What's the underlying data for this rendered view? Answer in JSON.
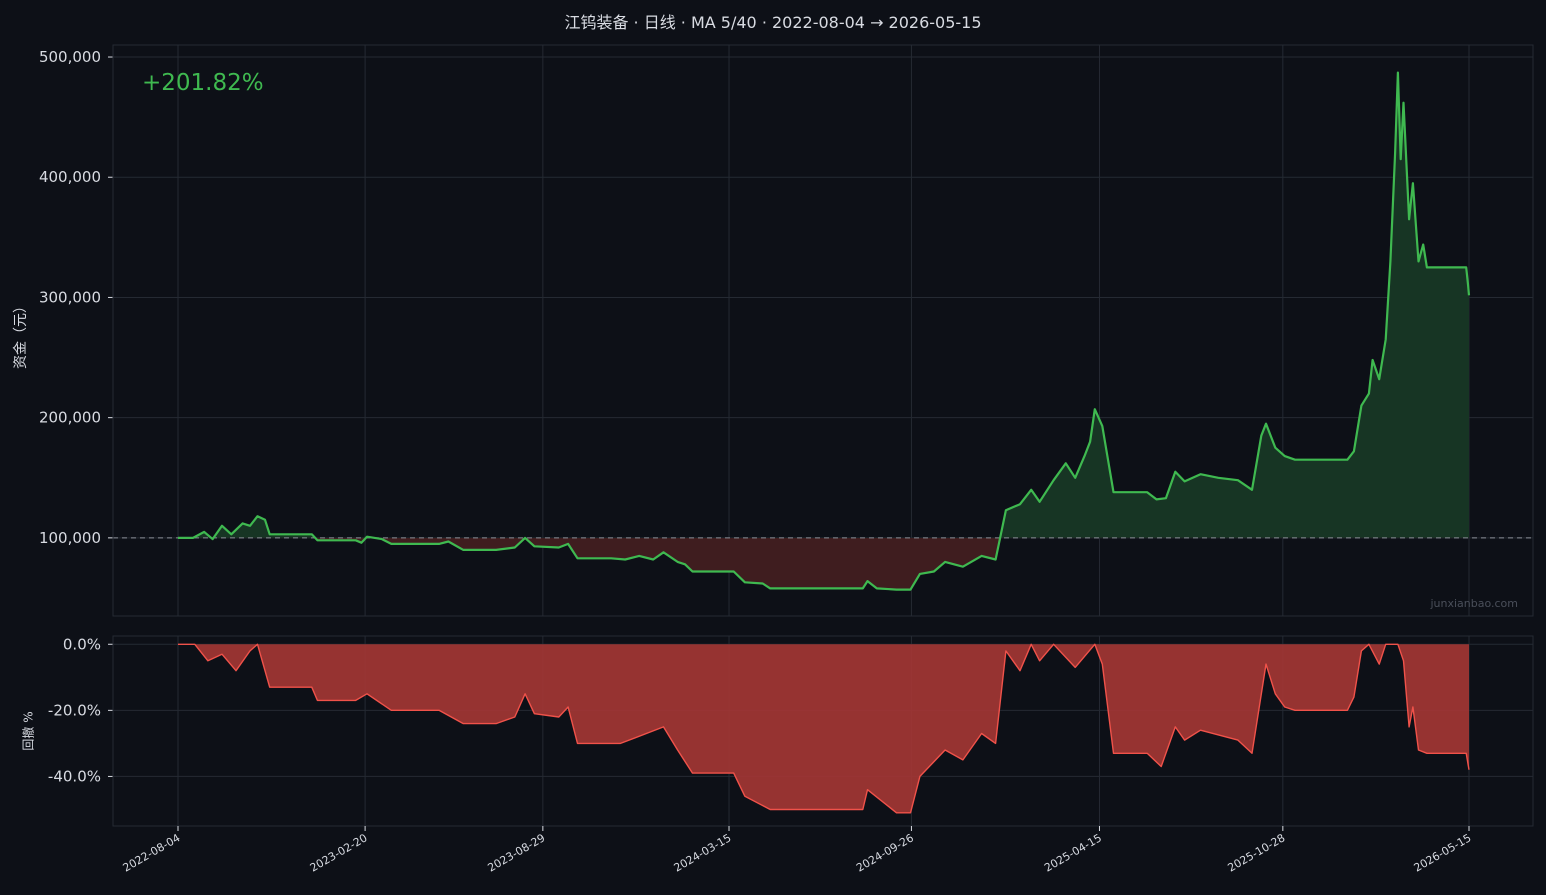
{
  "title": "江钨装备 · 日线 · MA 5/40 · 2022-08-04 → 2026-05-15",
  "return_label": "+201.82%",
  "watermark": "junxianbao.com",
  "colors": {
    "background": "#0d1017",
    "grid": "#252a33",
    "equity_line": "#3fb950",
    "gain_fill": "#173524",
    "loss_fill": "#3f1d1f",
    "drawdown_line": "#f0524a",
    "drawdown_fill": "#a23634",
    "baseline": "#8b8f98",
    "text": "#d8dbe2"
  },
  "chart_data": [
    {
      "type": "line",
      "ylabel": "资金（元）",
      "ylim": [
        35000,
        510000
      ],
      "yticks": [
        100000,
        200000,
        300000,
        400000,
        500000
      ],
      "ytick_labels": [
        "100,000",
        "200,000",
        "300,000",
        "400,000",
        "500,000"
      ],
      "baseline": 100000,
      "grid": true,
      "annotation": "+201.82%",
      "series": [
        {
          "values": [
            [
              "2022-08-04",
              100000
            ],
            [
              "2022-08-20",
              100000
            ],
            [
              "2022-09-01",
              105000
            ],
            [
              "2022-09-10",
              99000
            ],
            [
              "2022-09-20",
              110000
            ],
            [
              "2022-09-30",
              103000
            ],
            [
              "2022-10-12",
              112000
            ],
            [
              "2022-10-20",
              110000
            ],
            [
              "2022-10-28",
              118000
            ],
            [
              "2022-11-05",
              115000
            ],
            [
              "2022-11-10",
              103000
            ],
            [
              "2022-12-25",
              103000
            ],
            [
              "2022-12-31",
              98000
            ],
            [
              "2023-02-10",
              98000
            ],
            [
              "2023-02-16",
              96000
            ],
            [
              "2023-02-22",
              101000
            ],
            [
              "2023-03-10",
              99000
            ],
            [
              "2023-03-20",
              95000
            ],
            [
              "2023-05-10",
              95000
            ],
            [
              "2023-05-20",
              97000
            ],
            [
              "2023-06-05",
              90000
            ],
            [
              "2023-07-10",
              90000
            ],
            [
              "2023-07-30",
              92000
            ],
            [
              "2023-08-10",
              100000
            ],
            [
              "2023-08-20",
              93000
            ],
            [
              "2023-09-15",
              92000
            ],
            [
              "2023-09-25",
              95000
            ],
            [
              "2023-10-05",
              83000
            ],
            [
              "2023-11-10",
              83000
            ],
            [
              "2023-11-25",
              82000
            ],
            [
              "2023-12-10",
              85000
            ],
            [
              "2023-12-25",
              82000
            ],
            [
              "2024-01-05",
              88000
            ],
            [
              "2024-01-20",
              80000
            ],
            [
              "2024-01-28",
              78000
            ],
            [
              "2024-02-05",
              72000
            ],
            [
              "2024-03-20",
              72000
            ],
            [
              "2024-04-01",
              63000
            ],
            [
              "2024-04-20",
              62000
            ],
            [
              "2024-04-28",
              58000
            ],
            [
              "2024-08-05",
              58000
            ],
            [
              "2024-08-10",
              64000
            ],
            [
              "2024-08-20",
              58000
            ],
            [
              "2024-09-10",
              57000
            ],
            [
              "2024-09-25",
              57000
            ],
            [
              "2024-10-05",
              70000
            ],
            [
              "2024-10-20",
              72000
            ],
            [
              "2024-11-01",
              80000
            ],
            [
              "2024-11-20",
              76000
            ],
            [
              "2024-12-10",
              85000
            ],
            [
              "2024-12-25",
              82000
            ],
            [
              "2025-01-05",
              123000
            ],
            [
              "2025-01-20",
              128000
            ],
            [
              "2025-02-01",
              140000
            ],
            [
              "2025-02-10",
              130000
            ],
            [
              "2025-02-25",
              148000
            ],
            [
              "2025-03-10",
              162000
            ],
            [
              "2025-03-20",
              150000
            ],
            [
              "2025-03-30",
              168000
            ],
            [
              "2025-04-05",
              180000
            ],
            [
              "2025-04-10",
              207000
            ],
            [
              "2025-04-18",
              193000
            ],
            [
              "2025-04-30",
              138000
            ],
            [
              "2025-06-05",
              138000
            ],
            [
              "2025-06-15",
              132000
            ],
            [
              "2025-06-25",
              133000
            ],
            [
              "2025-07-05",
              155000
            ],
            [
              "2025-07-15",
              147000
            ],
            [
              "2025-08-01",
              153000
            ],
            [
              "2025-08-20",
              150000
            ],
            [
              "2025-09-10",
              148000
            ],
            [
              "2025-09-25",
              140000
            ],
            [
              "2025-10-05",
              185000
            ],
            [
              "2025-10-10",
              195000
            ],
            [
              "2025-10-20",
              175000
            ],
            [
              "2025-10-30",
              168000
            ],
            [
              "2025-11-10",
              165000
            ],
            [
              "2026-01-05",
              165000
            ],
            [
              "2026-01-12",
              172000
            ],
            [
              "2026-01-20",
              210000
            ],
            [
              "2026-01-28",
              220000
            ],
            [
              "2026-02-01",
              248000
            ],
            [
              "2026-02-08",
              232000
            ],
            [
              "2026-02-15",
              265000
            ],
            [
              "2026-02-20",
              330000
            ],
            [
              "2026-02-25",
              420000
            ],
            [
              "2026-02-28",
              487000
            ],
            [
              "2026-03-03",
              415000
            ],
            [
              "2026-03-06",
              462000
            ],
            [
              "2026-03-12",
              365000
            ],
            [
              "2026-03-16",
              395000
            ],
            [
              "2026-03-22",
              330000
            ],
            [
              "2026-03-27",
              344000
            ],
            [
              "2026-03-31",
              325000
            ],
            [
              "2026-05-12",
              325000
            ],
            [
              "2026-05-14",
              310000
            ],
            [
              "2026-05-15",
              301820
            ]
          ]
        }
      ]
    },
    {
      "type": "area",
      "ylabel": "回撤 %",
      "ylim": [
        -55,
        2.5
      ],
      "yticks": [
        0,
        -20,
        -40
      ],
      "ytick_labels": [
        "0.0%",
        "-20.0%",
        "-40.0%"
      ],
      "grid": true,
      "x_ticks": [
        "2022-08-04",
        "2023-02-20",
        "2023-08-29",
        "2024-03-15",
        "2024-09-26",
        "2025-04-15",
        "2025-10-28",
        "2026-05-15"
      ],
      "series": [
        {
          "values": [
            [
              "2022-08-04",
              0
            ],
            [
              "2022-08-22",
              0
            ],
            [
              "2022-09-05",
              -5
            ],
            [
              "2022-09-20",
              -3
            ],
            [
              "2022-10-05",
              -8
            ],
            [
              "2022-10-20",
              -2
            ],
            [
              "2022-10-28",
              0
            ],
            [
              "2022-11-10",
              -13
            ],
            [
              "2022-12-25",
              -13
            ],
            [
              "2022-12-31",
              -17
            ],
            [
              "2023-02-10",
              -17
            ],
            [
              "2023-02-22",
              -15
            ],
            [
              "2023-03-20",
              -20
            ],
            [
              "2023-05-10",
              -20
            ],
            [
              "2023-06-05",
              -24
            ],
            [
              "2023-07-10",
              -24
            ],
            [
              "2023-07-30",
              -22
            ],
            [
              "2023-08-10",
              -15
            ],
            [
              "2023-08-20",
              -21
            ],
            [
              "2023-09-15",
              -22
            ],
            [
              "2023-09-25",
              -19
            ],
            [
              "2023-10-05",
              -30
            ],
            [
              "2023-11-20",
              -30
            ],
            [
              "2024-01-05",
              -25
            ],
            [
              "2024-01-20",
              -32
            ],
            [
              "2024-02-05",
              -39
            ],
            [
              "2024-03-20",
              -39
            ],
            [
              "2024-04-01",
              -46
            ],
            [
              "2024-04-28",
              -50
            ],
            [
              "2024-08-05",
              -50
            ],
            [
              "2024-08-10",
              -44
            ],
            [
              "2024-09-10",
              -51
            ],
            [
              "2024-09-25",
              -51
            ],
            [
              "2024-10-05",
              -40
            ],
            [
              "2024-11-01",
              -32
            ],
            [
              "2024-11-20",
              -35
            ],
            [
              "2024-12-10",
              -27
            ],
            [
              "2024-12-25",
              -30
            ],
            [
              "2025-01-05",
              -2
            ],
            [
              "2025-01-20",
              -8
            ],
            [
              "2025-02-01",
              0
            ],
            [
              "2025-02-10",
              -5
            ],
            [
              "2025-02-25",
              0
            ],
            [
              "2025-03-20",
              -7
            ],
            [
              "2025-04-10",
              0
            ],
            [
              "2025-04-18",
              -6
            ],
            [
              "2025-04-30",
              -33
            ],
            [
              "2025-06-05",
              -33
            ],
            [
              "2025-06-20",
              -37
            ],
            [
              "2025-07-05",
              -25
            ],
            [
              "2025-07-15",
              -29
            ],
            [
              "2025-08-01",
              -26
            ],
            [
              "2025-09-10",
              -29
            ],
            [
              "2025-09-25",
              -33
            ],
            [
              "2025-10-10",
              -6
            ],
            [
              "2025-10-20",
              -15
            ],
            [
              "2025-10-30",
              -19
            ],
            [
              "2025-11-10",
              -20
            ],
            [
              "2026-01-05",
              -20
            ],
            [
              "2026-01-12",
              -16
            ],
            [
              "2026-01-20",
              -2
            ],
            [
              "2026-01-28",
              0
            ],
            [
              "2026-02-08",
              -6
            ],
            [
              "2026-02-15",
              0
            ],
            [
              "2026-02-28",
              0
            ],
            [
              "2026-03-06",
              -5
            ],
            [
              "2026-03-12",
              -25
            ],
            [
              "2026-03-16",
              -19
            ],
            [
              "2026-03-22",
              -32
            ],
            [
              "2026-03-31",
              -33
            ],
            [
              "2026-05-12",
              -33
            ],
            [
              "2026-05-15",
              -38
            ]
          ]
        }
      ]
    }
  ]
}
